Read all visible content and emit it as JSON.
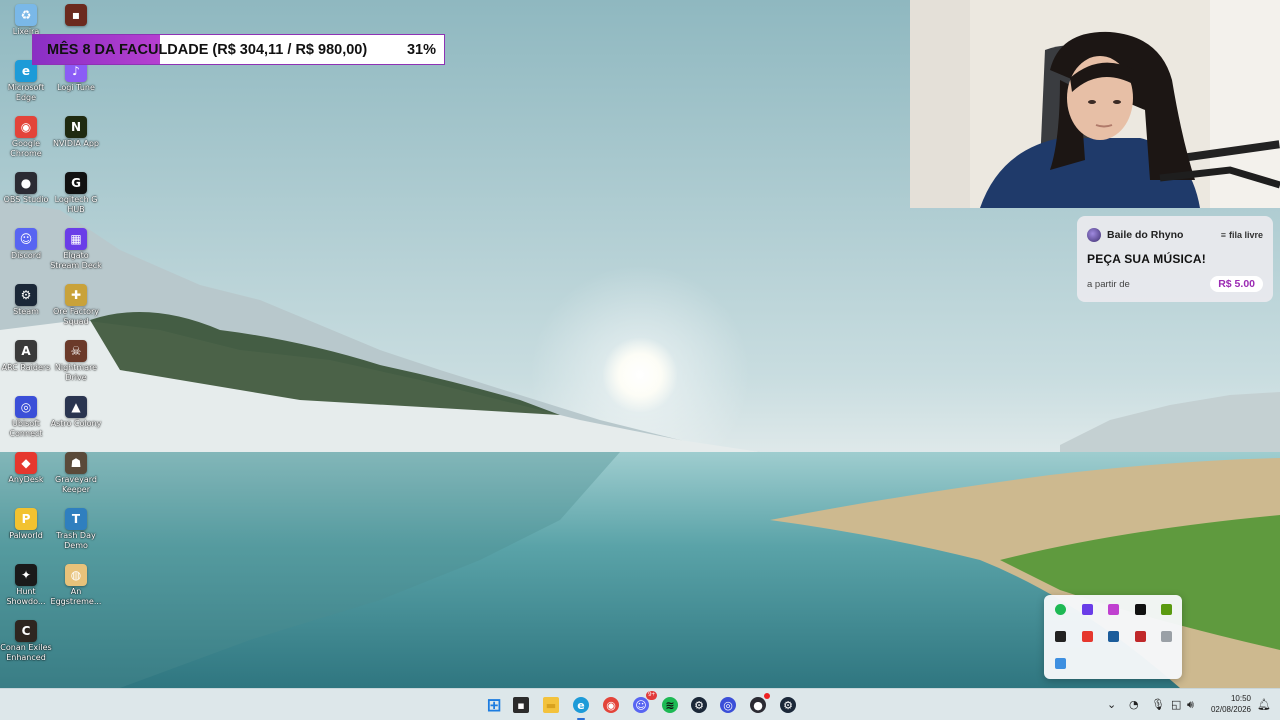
{
  "colors": {
    "goal_fill": "#9a33c8",
    "accent_purple": "#9b2bb3",
    "taskbar_bg": "#dde7ea"
  },
  "desktop": {
    "icons": [
      {
        "label": "Lixeira",
        "icon": "recycle-bin-icon",
        "color": "#7ab8e8",
        "glyph": "♻"
      },
      {
        "label": "Microsoft\nEdge",
        "icon": "edge-icon",
        "color": "#1d9bd8",
        "glyph": "e"
      },
      {
        "label": "Google\nChrome",
        "icon": "chrome-icon",
        "color": "#e3443a",
        "glyph": "◉"
      },
      {
        "label": "OBS Studio",
        "icon": "obs-icon",
        "color": "#2b2b33",
        "glyph": "●"
      },
      {
        "label": "Discord",
        "icon": "discord-icon",
        "color": "#5865f2",
        "glyph": "☺"
      },
      {
        "label": "Steam",
        "icon": "steam-icon",
        "color": "#1b2838",
        "glyph": "⚙"
      },
      {
        "label": "ARC Raiders",
        "icon": "arc-raiders-icon",
        "color": "#3a3a3a",
        "glyph": "A"
      },
      {
        "label": "Ubisoft\nConnect",
        "icon": "ubisoft-icon",
        "color": "#3b4fd8",
        "glyph": "◎"
      },
      {
        "label": "AnyDesk",
        "icon": "anydesk-icon",
        "color": "#e6372e",
        "glyph": "◆"
      },
      {
        "label": "Palworld",
        "icon": "palworld-icon",
        "color": "#f2c230",
        "glyph": "P"
      },
      {
        "label": "Hunt\nShowdo...",
        "icon": "hunt-showdown-icon",
        "color": "#1a1a1a",
        "glyph": "✦"
      },
      {
        "label": "Conan Exiles\nEnhanced",
        "icon": "conan-exiles-icon",
        "color": "#2e2620",
        "glyph": "C"
      },
      {
        "label": "",
        "icon": "game-icon",
        "color": "#6b2a1e",
        "glyph": "▪"
      },
      {
        "label": "Logi Tune",
        "icon": "logi-tune-icon",
        "color": "#8b5cf6",
        "glyph": "♪"
      },
      {
        "label": "NVIDIA App",
        "icon": "nvidia-icon",
        "color": "#1f2a10",
        "glyph": "N"
      },
      {
        "label": "Logitech G\nHUB",
        "icon": "logitech-ghub-icon",
        "color": "#111111",
        "glyph": "G"
      },
      {
        "label": "Elgato\nStream Deck",
        "icon": "stream-deck-icon",
        "color": "#6a3de8",
        "glyph": "▦"
      },
      {
        "label": "Ore Factory\nSquad",
        "icon": "ore-factory-icon",
        "color": "#c9a23a",
        "glyph": "✚"
      },
      {
        "label": "Nightmare\nDrive",
        "icon": "nightmare-drive-icon",
        "color": "#6b3a2a",
        "glyph": "☠"
      },
      {
        "label": "Astro Colony",
        "icon": "astro-colony-icon",
        "color": "#2a3550",
        "glyph": "▲"
      },
      {
        "label": "Graveyard\nKeeper",
        "icon": "graveyard-keeper-icon",
        "color": "#5a4a3a",
        "glyph": "☗"
      },
      {
        "label": "Trash Day\nDemo",
        "icon": "trash-day-icon",
        "color": "#2f7fbf",
        "glyph": "T"
      },
      {
        "label": "An\nEggstreme...",
        "icon": "eggstreme-icon",
        "color": "#e8c27a",
        "glyph": "◍"
      }
    ]
  },
  "goal": {
    "label": "MÊS 8 DA FACULDADE (R$ 304,11 / R$ 980,00)",
    "percent_text": "31%",
    "progress": 0.31
  },
  "song_request": {
    "streamer": "Baile do Rhyno",
    "queue_label": "fila livre",
    "cta": "PEÇA SUA MÚSICA!",
    "from_label": "a partir de",
    "price": "R$ 5.00"
  },
  "tray_popup": {
    "icons": [
      {
        "name": "spotify-tray-icon",
        "color": "#1db954"
      },
      {
        "name": "stream-deck-tray-icon",
        "color": "#6a3de8"
      },
      {
        "name": "app-tray-icon",
        "color": "#c040d0"
      },
      {
        "name": "ghub-tray-icon",
        "color": "#111111"
      },
      {
        "name": "nvidia-tray-icon",
        "color": "#5a9a10"
      },
      {
        "name": "obs-tray-icon",
        "color": "#222222"
      },
      {
        "name": "anydesk-tray-icon",
        "color": "#e6372e"
      },
      {
        "name": "steam-tray-icon",
        "color": "#1b5c9b"
      },
      {
        "name": "game-tray-icon",
        "color": "#c0282a"
      },
      {
        "name": "misc-tray-icon",
        "color": "#9aa0a6"
      },
      {
        "name": "network-tray-icon",
        "color": "#3d8fe0"
      }
    ]
  },
  "taskbar": {
    "apps": [
      {
        "name": "start-button",
        "icon": "windows-icon"
      },
      {
        "name": "taskbar-app-terminal",
        "icon": "terminal-icon"
      },
      {
        "name": "taskbar-app-explorer",
        "icon": "folder-icon"
      },
      {
        "name": "taskbar-app-edge",
        "icon": "edge-icon"
      },
      {
        "name": "taskbar-app-chrome",
        "icon": "chrome-icon"
      },
      {
        "name": "taskbar-app-discord",
        "icon": "discord-icon"
      },
      {
        "name": "taskbar-app-spotify",
        "icon": "spotify-icon"
      },
      {
        "name": "taskbar-app-steam",
        "icon": "steam-icon"
      },
      {
        "name": "taskbar-app-ubisoft",
        "icon": "ubisoft-icon"
      },
      {
        "name": "taskbar-app-obs",
        "icon": "obs-icon"
      },
      {
        "name": "taskbar-app-steam-2",
        "icon": "steam-icon"
      }
    ],
    "discord_badge": "9+",
    "time": "10:50",
    "date": "02/08/2026"
  }
}
